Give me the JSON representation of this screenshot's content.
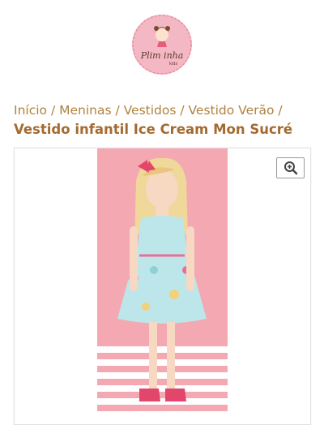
{
  "logo": {
    "text": "Plim inha",
    "sub": "kids"
  },
  "breadcrumb": {
    "items": [
      "Início",
      "Meninas",
      "Vestidos",
      "Vestido Verão"
    ],
    "separator": "/"
  },
  "product": {
    "title": "Vestido infantil Ice Cream Mon Sucré"
  },
  "icons": {
    "zoom": "zoom-in-icon"
  },
  "colors": {
    "accent": "#b0823f",
    "title": "#a46a30",
    "photo_bg": "#f3a8b2",
    "logo_bg": "#f3b8c3"
  }
}
